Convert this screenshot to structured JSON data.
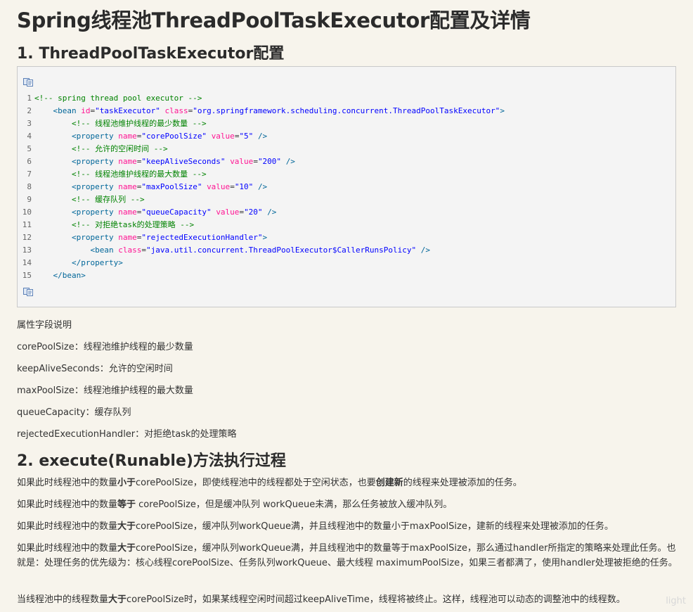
{
  "title": "Spring线程池ThreadPoolTaskExecutor配置及详情",
  "section1": {
    "heading": "1. ThreadPoolTaskExecutor配置"
  },
  "code": {
    "lines": [
      {
        "num": "1",
        "indent": "",
        "parts": [
          {
            "t": "<!-- spring thread pool executor -->",
            "c": "cm"
          }
        ]
      },
      {
        "num": "2",
        "indent": "    ",
        "parts": [
          {
            "t": "<bean ",
            "c": "tg"
          },
          {
            "t": "id",
            "c": "at"
          },
          {
            "t": "=",
            "c": ""
          },
          {
            "t": "\"taskExecutor\" ",
            "c": "vl"
          },
          {
            "t": "class",
            "c": "at"
          },
          {
            "t": "=",
            "c": ""
          },
          {
            "t": "\"org.springframework.scheduling.concurrent.ThreadPoolTaskExecutor\"",
            "c": "vl"
          },
          {
            "t": ">",
            "c": "tg"
          }
        ]
      },
      {
        "num": "3",
        "indent": "        ",
        "parts": [
          {
            "t": "<!-- 线程池维护线程的最少数量 -->",
            "c": "cm"
          }
        ]
      },
      {
        "num": "4",
        "indent": "        ",
        "parts": [
          {
            "t": "<property ",
            "c": "tg"
          },
          {
            "t": "name",
            "c": "at"
          },
          {
            "t": "=",
            "c": ""
          },
          {
            "t": "\"corePoolSize\" ",
            "c": "vl"
          },
          {
            "t": "value",
            "c": "at"
          },
          {
            "t": "=",
            "c": ""
          },
          {
            "t": "\"5\" ",
            "c": "vl"
          },
          {
            "t": "/>",
            "c": "tg"
          }
        ]
      },
      {
        "num": "5",
        "indent": "        ",
        "parts": [
          {
            "t": "<!-- 允许的空闲时间 -->",
            "c": "cm"
          }
        ]
      },
      {
        "num": "6",
        "indent": "        ",
        "parts": [
          {
            "t": "<property ",
            "c": "tg"
          },
          {
            "t": "name",
            "c": "at"
          },
          {
            "t": "=",
            "c": ""
          },
          {
            "t": "\"keepAliveSeconds\" ",
            "c": "vl"
          },
          {
            "t": "value",
            "c": "at"
          },
          {
            "t": "=",
            "c": ""
          },
          {
            "t": "\"200\" ",
            "c": "vl"
          },
          {
            "t": "/>",
            "c": "tg"
          }
        ]
      },
      {
        "num": "7",
        "indent": "        ",
        "parts": [
          {
            "t": "<!-- 线程池维护线程的最大数量 -->",
            "c": "cm"
          }
        ]
      },
      {
        "num": "8",
        "indent": "        ",
        "parts": [
          {
            "t": "<property ",
            "c": "tg"
          },
          {
            "t": "name",
            "c": "at"
          },
          {
            "t": "=",
            "c": ""
          },
          {
            "t": "\"maxPoolSize\" ",
            "c": "vl"
          },
          {
            "t": "value",
            "c": "at"
          },
          {
            "t": "=",
            "c": ""
          },
          {
            "t": "\"10\" ",
            "c": "vl"
          },
          {
            "t": "/>",
            "c": "tg"
          }
        ]
      },
      {
        "num": "9",
        "indent": "        ",
        "parts": [
          {
            "t": "<!-- 缓存队列 -->",
            "c": "cm"
          }
        ]
      },
      {
        "num": "10",
        "indent": "        ",
        "parts": [
          {
            "t": "<property ",
            "c": "tg"
          },
          {
            "t": "name",
            "c": "at"
          },
          {
            "t": "=",
            "c": ""
          },
          {
            "t": "\"queueCapacity\" ",
            "c": "vl"
          },
          {
            "t": "value",
            "c": "at"
          },
          {
            "t": "=",
            "c": ""
          },
          {
            "t": "\"20\" ",
            "c": "vl"
          },
          {
            "t": "/>",
            "c": "tg"
          }
        ]
      },
      {
        "num": "11",
        "indent": "        ",
        "parts": [
          {
            "t": "<!-- 对拒绝task的处理策略 -->",
            "c": "cm"
          }
        ]
      },
      {
        "num": "12",
        "indent": "        ",
        "parts": [
          {
            "t": "<property ",
            "c": "tg"
          },
          {
            "t": "name",
            "c": "at"
          },
          {
            "t": "=",
            "c": ""
          },
          {
            "t": "\"rejectedExecutionHandler\"",
            "c": "vl"
          },
          {
            "t": ">",
            "c": "tg"
          }
        ]
      },
      {
        "num": "13",
        "indent": "            ",
        "parts": [
          {
            "t": "<bean ",
            "c": "tg"
          },
          {
            "t": "class",
            "c": "at"
          },
          {
            "t": "=",
            "c": ""
          },
          {
            "t": "\"java.util.concurrent.ThreadPoolExecutor$CallerRunsPolicy\" ",
            "c": "vl"
          },
          {
            "t": "/>",
            "c": "tg"
          }
        ]
      },
      {
        "num": "14",
        "indent": "        ",
        "parts": [
          {
            "t": "</property>",
            "c": "tg"
          }
        ]
      },
      {
        "num": "15",
        "indent": "    ",
        "parts": [
          {
            "t": "</bean>",
            "c": "tg"
          }
        ]
      }
    ]
  },
  "fields": {
    "intro": "属性字段说明",
    "items": [
      "corePoolSize：线程池维护线程的最少数量",
      "keepAliveSeconds：允许的空闲时间",
      "maxPoolSize：线程池维护线程的最大数量",
      "queueCapacity：缓存队列",
      "rejectedExecutionHandler：对拒绝task的处理策略"
    ]
  },
  "section2": {
    "heading": "2. execute(Runable)方法执行过程",
    "p1": {
      "a": "如果此时线程池中的数量",
      "b1": "小于",
      "c": "corePoolSize，即使线程池中的线程都处于空闲状态，也要",
      "b2": "创建新",
      "d": "的线程来处理被添加的任务。"
    },
    "p2": {
      "a": "如果此时线程池中的数量",
      "b1": "等于",
      "c": " corePoolSize，但是缓冲队列 workQueue未满，那么任务被放入缓冲队列。"
    },
    "p3": {
      "a": "如果此时线程池中的数量",
      "b1": "大于",
      "c": "corePoolSize，缓冲队列workQueue满，并且线程池中的数量小于maxPoolSize，建新的线程来处理被添加的任务。"
    },
    "p4": {
      "a": "如果此时线程池中的数量",
      "b1": "大于",
      "c": "corePoolSize，缓冲队列workQueue满，并且线程池中的数量等于maxPoolSize，那么通过handler所指定的策略来处理此任务。也就是：处理任务的优先级为：核心线程corePoolSize、任务队列workQueue、最大线程 maximumPoolSize，如果三者都满了，使用handler处理被拒绝的任务。"
    },
    "p5": {
      "a": "当线程池中的线程数量",
      "b1": "大于",
      "c": "corePoolSize时，如果某线程空闲时间超过keepAliveTime，线程将被终止。这样，线程池可以动态的调整池中的线程数。"
    }
  },
  "watermark": "light"
}
